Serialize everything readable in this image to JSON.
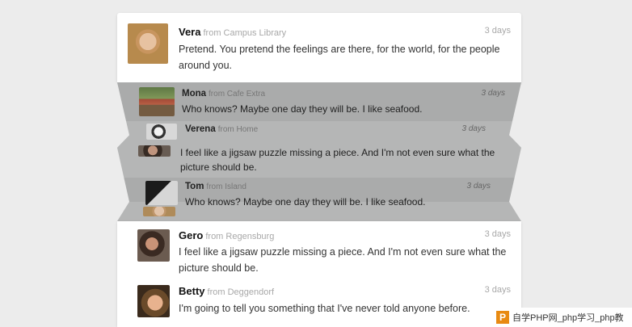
{
  "messages_top": [
    {
      "name": "Vera",
      "from": "from Campus Library",
      "time": "3 days",
      "text": "Pretend. You pretend the feelings are there, for the world, for the people around you."
    }
  ],
  "messages_folded": [
    {
      "name": "Mona",
      "from": "from Cafe Extra",
      "time": "3 days",
      "text": "Who knows? Maybe one day they will be. I like seafood."
    },
    {
      "name": "Verena",
      "from": "from Home",
      "time": "3 days"
    },
    {
      "text": "I feel like a jigsaw puzzle missing a piece. And I'm not even sure what the picture should be."
    },
    {
      "name": "Tom",
      "from": "from Island",
      "time": "3 days",
      "text": "Who knows? Maybe one day they will be. I like seafood."
    }
  ],
  "messages_bottom": [
    {
      "name": "Gero",
      "from": "from Regensburg",
      "time": "3 days",
      "text": "I feel like a jigsaw puzzle missing a piece. And I'm not even sure what the picture should be."
    },
    {
      "name": "Betty",
      "from": "from Deggendorf",
      "time": "3 days",
      "text": "I'm going to tell you something that I've never told anyone before."
    }
  ],
  "watermark": {
    "icon": "P",
    "text": "自学PHP网_php学习_php教"
  }
}
